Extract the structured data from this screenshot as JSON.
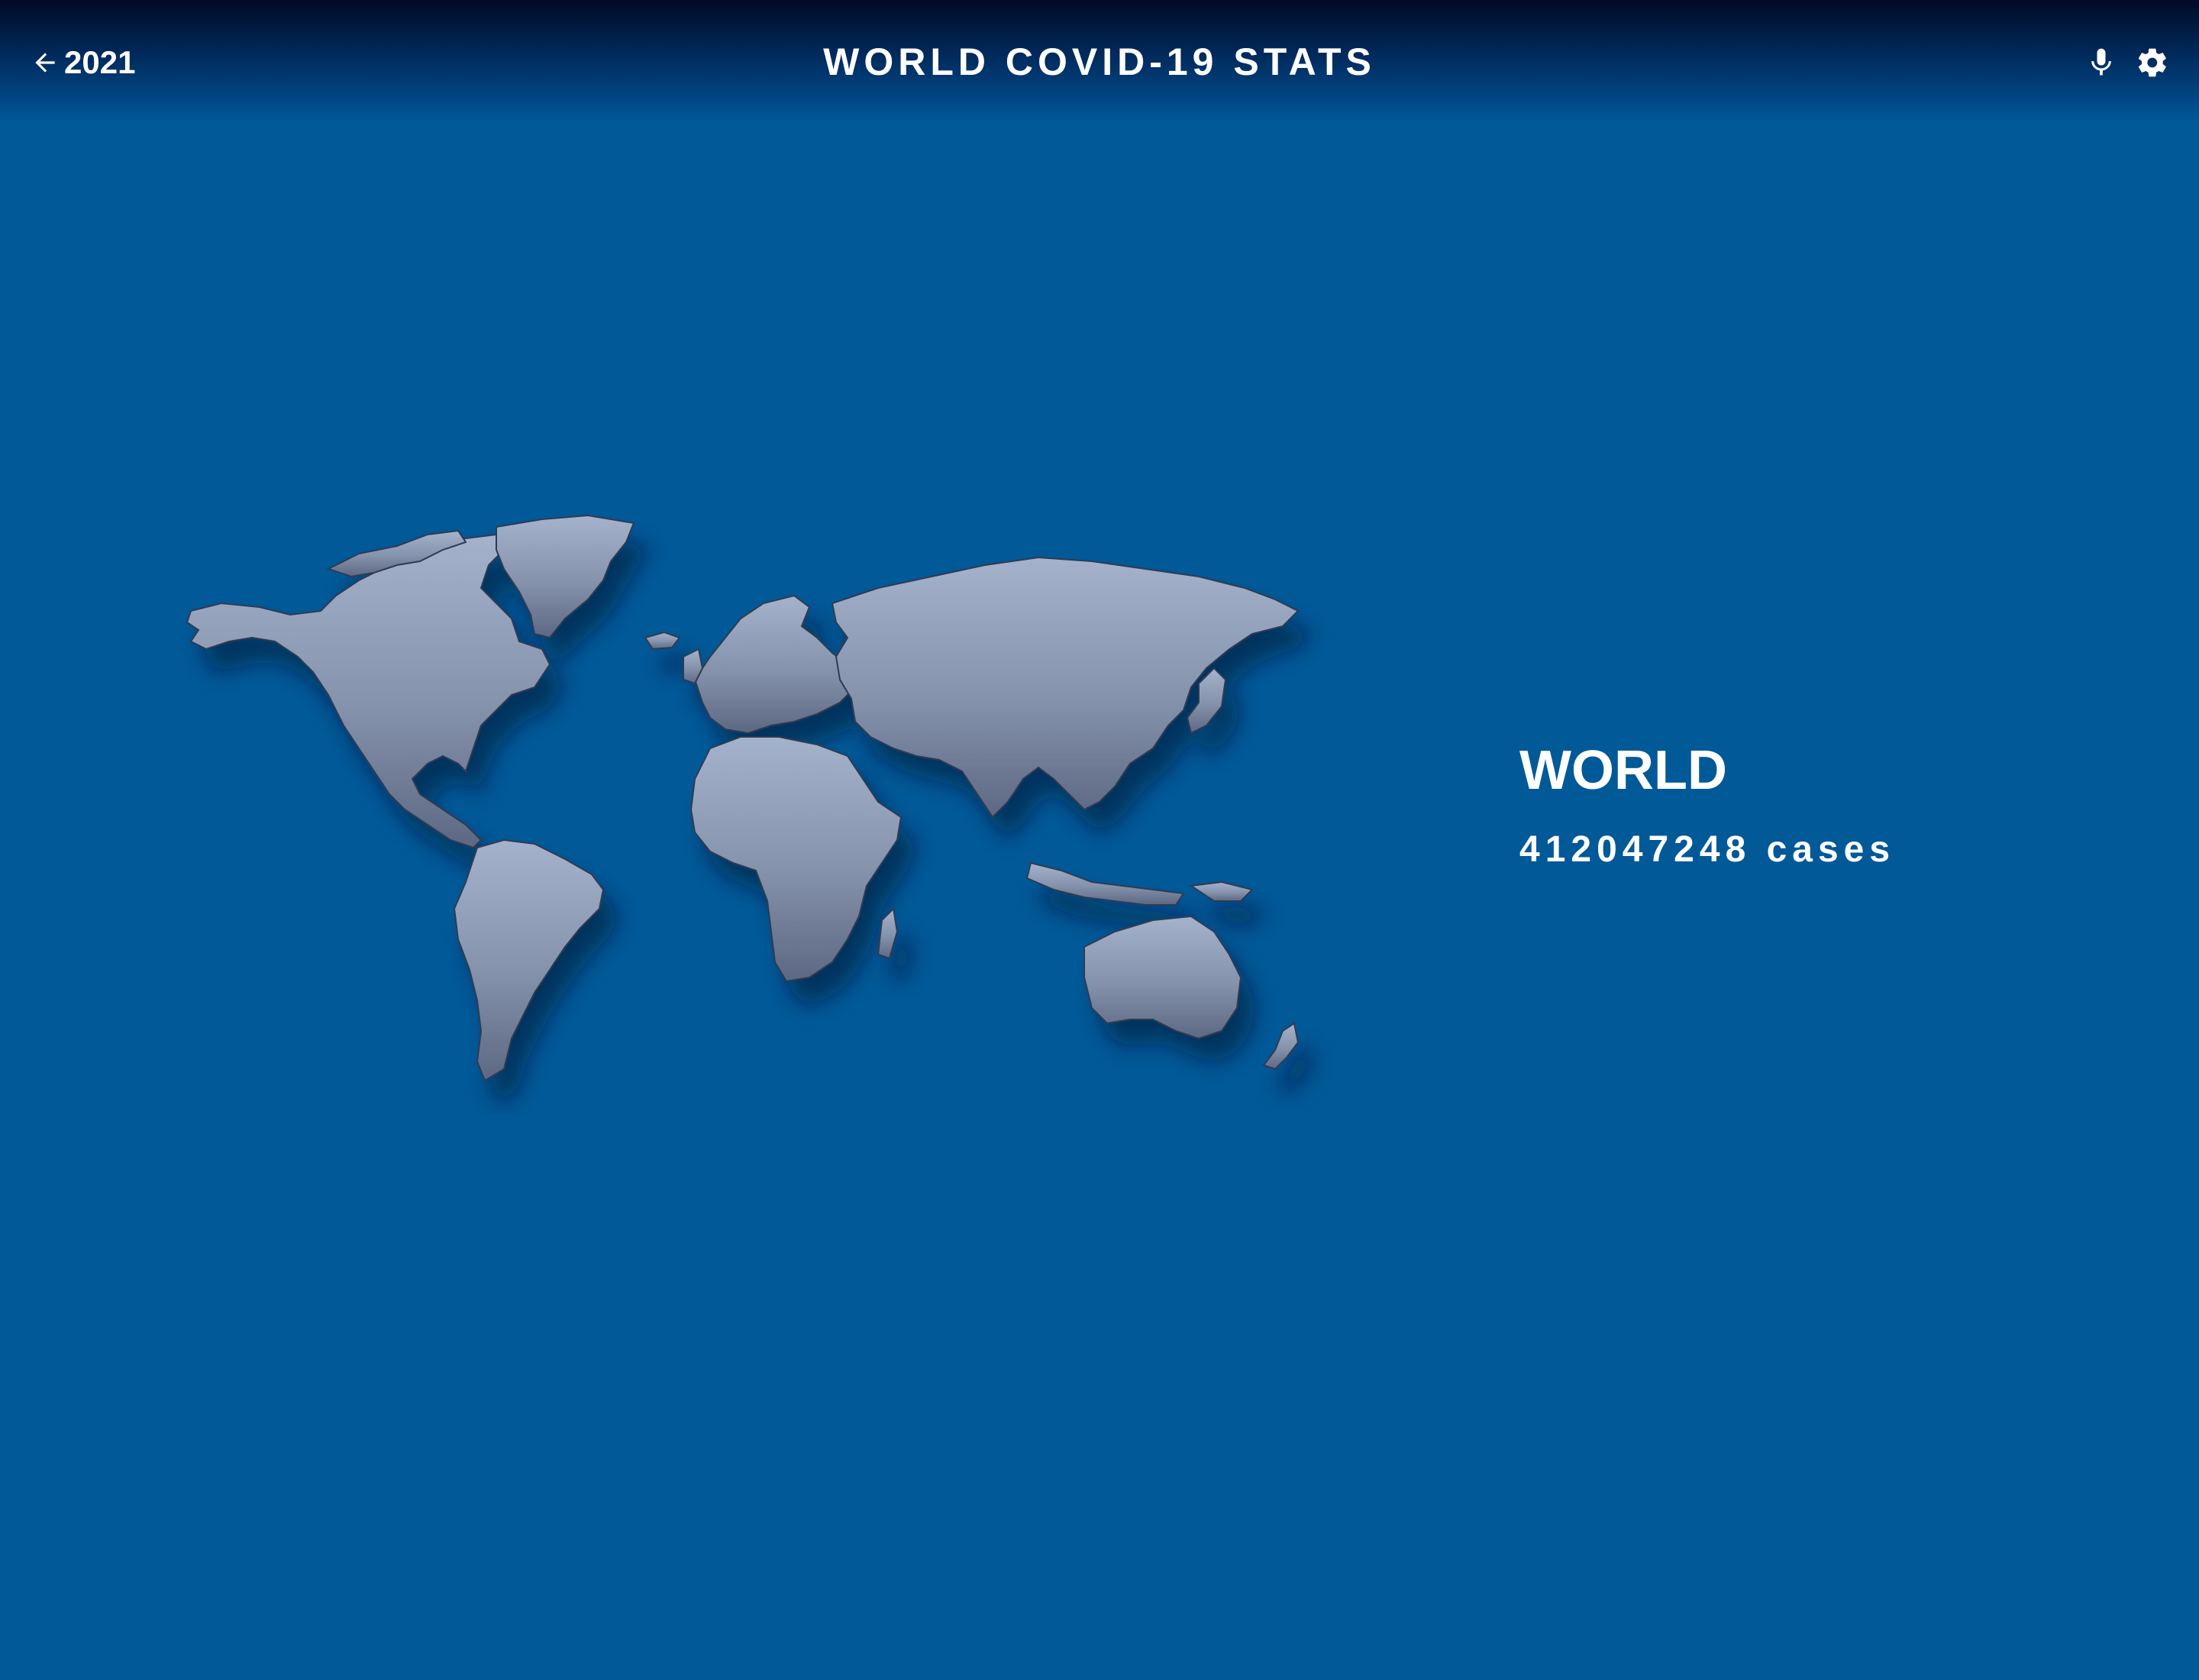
{
  "header": {
    "back_label": "2021",
    "title": "WORLD COVID-19 STATS",
    "icons": [
      "arrow-left-icon",
      "microphone-icon",
      "gear-icon"
    ]
  },
  "selection": {
    "region": "WORLD",
    "cases_text": "412047248 cases"
  },
  "colors": {
    "background": "#015998",
    "header_top": "#000a26",
    "land": "#8f9db8",
    "text": "#ffffff"
  }
}
